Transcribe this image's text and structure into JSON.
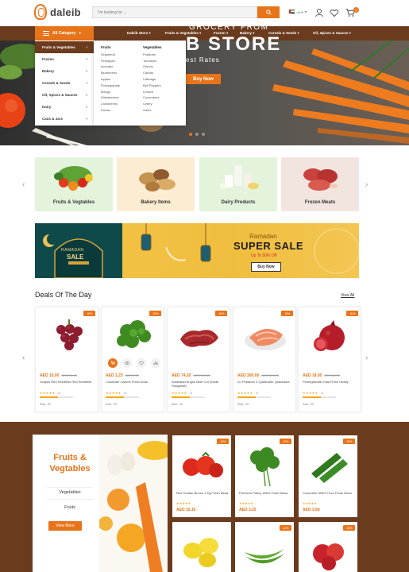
{
  "header": {
    "logo_text": "daleib",
    "search_placeholder": "I'm looking for ...",
    "language": "عربي",
    "cart_count": "0"
  },
  "nav": {
    "all_category": "All Category",
    "items": [
      "Daleib Store",
      "Fruits & Vegetables",
      "Frozen",
      "Bakery",
      "Cereals & Seeds",
      "Oil, Spices & Sauces"
    ]
  },
  "dropdown": {
    "categories": [
      "Fruits & Vegetables",
      "Frozen",
      "Bakery",
      "Cereals & Seeds",
      "Oil, Spices & Sauces",
      "Dairy",
      "Cans & Jars"
    ],
    "fruits_heading": "Fruits",
    "fruits": [
      "Grapefruit",
      "Pineapple",
      "Avocado",
      "Blueberries",
      "Apples",
      "Pomegranate",
      "Mango",
      "Strawberries",
      "Cranberries",
      "Durian"
    ],
    "vegetables_heading": "Vegetables",
    "vegetables": [
      "Potatoes",
      "Tomatoes",
      "Onions",
      "Carrots",
      "Cabbage",
      "Bell Peppers",
      "Lettuce",
      "Cucumbers",
      "Celery",
      "Garlic"
    ]
  },
  "hero": {
    "line1": "GROCERY FROM",
    "line2": "B STORE",
    "line3": "est Rates",
    "button": "Buy Now"
  },
  "categories": [
    "Fruits & Vegtables",
    "Bakery Items",
    "Dairy Products",
    "Frozen Meats"
  ],
  "banner": {
    "left_line1": "RAMADAN",
    "left_line2": "SALE",
    "ramadan": "Ramadan",
    "title": "SUPER SALE",
    "subtitle": "Up To 50% Off",
    "button": "Buy Now"
  },
  "deals": {
    "title": "Deals Of The Day",
    "view_all": "View All",
    "products": [
      {
        "name": "Grapes Red Seedless Red Seedless",
        "price": "AED 15.00",
        "old": "AED 24.00",
        "badge": "-30%",
        "rating": "0",
        "sold": "Sold : 03",
        "sold_fraction": 0.55
      },
      {
        "name": "Coriander Leaves Fresh India",
        "price": "AED 1.23",
        "old": "AED 2.00",
        "badge": "-20%",
        "rating": "0",
        "sold": "Sold : 03",
        "sold_fraction": 0.55
      },
      {
        "name": "Australian Angus Beef Cut (Small Stroganof)",
        "price": "AED 74.20",
        "old": "AED 110.00",
        "badge": "-40%",
        "rating": "0",
        "sold": "Sold : 03",
        "sold_fraction": 0.55
      },
      {
        "name": "DJ Pheatom 4 Quadrador Quadrador",
        "price": "AED 300.00",
        "old": "AED 320.00",
        "badge": "-30%",
        "rating": "0",
        "sold": "Sold : 03",
        "sold_fraction": 0.55
      },
      {
        "name": "Pomegranate India Fresh Healty",
        "price": "AED 18.00",
        "old": "AED 22.00",
        "badge": "-30%",
        "rating": "0",
        "sold": "Sold : 03",
        "sold_fraction": 0.55
      }
    ]
  },
  "fv_panel": {
    "title": "Fruits & Vegtables",
    "items": [
      "Vegetables",
      "Fruits"
    ],
    "button": "View More"
  },
  "fv_products": [
    {
      "name": "Red Tomato Bunch 1 Kg Fresh Nesa",
      "price": "AED 10.10",
      "badge": "-40%"
    },
    {
      "name": "Premium Parley 200G Fresh Nesa",
      "price": "AED 3.25",
      "badge": "-20%"
    },
    {
      "name": "Cucumber 500G From Fresh Nesa",
      "price": "AED 3.60",
      "badge": "-30%"
    },
    {
      "name": "",
      "price": "",
      "badge": ""
    },
    {
      "name": "",
      "price": "",
      "badge": "-10%"
    },
    {
      "name": "",
      "price": "",
      "badge": "-30%"
    }
  ],
  "stars": "★★★★★"
}
